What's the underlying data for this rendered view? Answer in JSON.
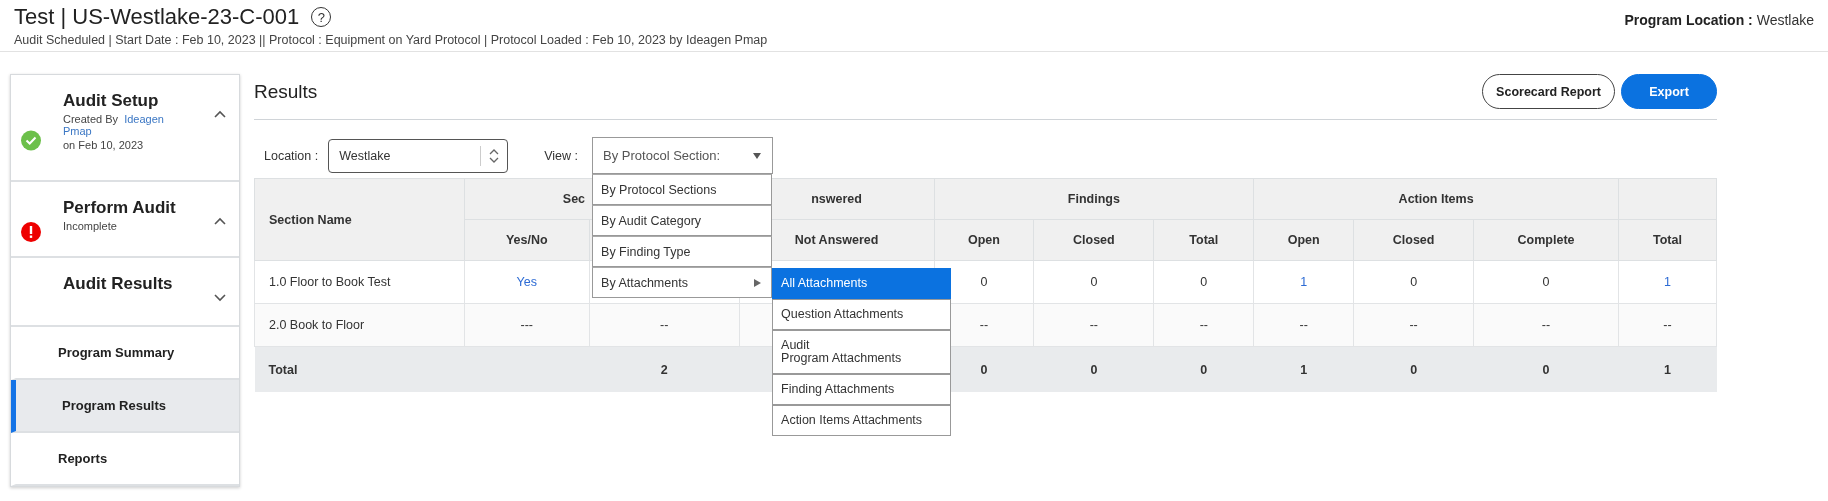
{
  "header": {
    "title": "Test | US-Westlake-23-C-001",
    "help": "?",
    "subtitle": "Audit Scheduled | Start Date : Feb 10, 2023 || Protocol : Equipment on Yard Protocol | Protocol Loaded : Feb 10, 2023 by Ideagen Pmap",
    "location_label": "Program Location :",
    "location_value": "Westlake"
  },
  "sidebar": {
    "steps": [
      {
        "title": "Audit Setup",
        "kind": "complete",
        "expanded": true,
        "prefix": "Created By",
        "author": "Ideagen Pmap",
        "date": "on Feb 10, 2023"
      },
      {
        "title": "Perform Audit",
        "kind": "error",
        "expanded": true,
        "note": "Incomplete"
      },
      {
        "title": "Audit Results",
        "kind": "plain",
        "expanded": false
      }
    ],
    "items": [
      {
        "label": "Program Summary",
        "selected": false
      },
      {
        "label": "Program Results",
        "selected": true
      },
      {
        "label": "Reports",
        "selected": false
      }
    ]
  },
  "results": {
    "title": "Results",
    "buttons": [
      {
        "label": "Scorecard Report",
        "kind": "outline"
      },
      {
        "label": "Export",
        "kind": "primary"
      }
    ],
    "location": {
      "label": "Location :",
      "value": "Westlake"
    },
    "view": {
      "label": "View :",
      "value": "By Protocol Section:",
      "options": [
        {
          "label": "By Protocol Sections",
          "submenu": false
        },
        {
          "label": "By Audit Category",
          "submenu": false
        },
        {
          "label": "By Finding Type",
          "submenu": false
        },
        {
          "label": "By Attachments",
          "submenu": true
        }
      ],
      "submenu": [
        {
          "label": "All Attachments",
          "selected": true
        },
        {
          "label": "Question Attachments",
          "selected": false
        },
        {
          "label": "Audit\nProgram Attachments",
          "selected": false
        },
        {
          "label": "Finding Attachments",
          "selected": false
        },
        {
          "label": "Action Items Attachments",
          "selected": false
        }
      ]
    },
    "table": {
      "groups": [
        {
          "label": "Sec"
        },
        {
          "label": "nswered"
        },
        {
          "label": "Findings"
        },
        {
          "label": "Action Items"
        }
      ],
      "columns": [
        "Section Name",
        "Yes/No",
        null,
        "Not Answered",
        "Open",
        "Closed",
        "Total",
        "Open",
        "Closed",
        "Complete",
        "Total"
      ],
      "rows": [
        {
          "kind": "data",
          "cells": [
            {
              "text": "1.0 Floor to Book Test",
              "link": false
            },
            {
              "text": "Yes",
              "link": true
            },
            null,
            null,
            {
              "text": "0",
              "link": false
            },
            {
              "text": "0",
              "link": false
            },
            {
              "text": "0",
              "link": false
            },
            {
              "text": "1",
              "link": true
            },
            {
              "text": "0",
              "link": false
            },
            {
              "text": "0",
              "link": false
            },
            {
              "text": "1",
              "link": true
            }
          ]
        },
        {
          "kind": "data",
          "cells": [
            {
              "text": "2.0 Book to Floor",
              "link": false
            },
            {
              "text": "---",
              "link": false
            },
            {
              "text": "--",
              "link": false
            },
            null,
            {
              "text": "--",
              "link": false
            },
            {
              "text": "--",
              "link": false
            },
            {
              "text": "--",
              "link": false
            },
            {
              "text": "--",
              "link": false
            },
            {
              "text": "--",
              "link": false
            },
            {
              "text": "--",
              "link": false
            },
            {
              "text": "--",
              "link": false
            }
          ]
        },
        {
          "kind": "total",
          "cells": [
            {
              "text": "Total",
              "link": false
            },
            null,
            {
              "text": "2",
              "link": false
            },
            null,
            {
              "text": "0",
              "link": false
            },
            {
              "text": "0",
              "link": false
            },
            {
              "text": "0",
              "link": false
            },
            {
              "text": "1",
              "link": false
            },
            {
              "text": "0",
              "link": false
            },
            {
              "text": "0",
              "link": false
            },
            {
              "text": "1",
              "link": false
            }
          ]
        }
      ]
    }
  }
}
